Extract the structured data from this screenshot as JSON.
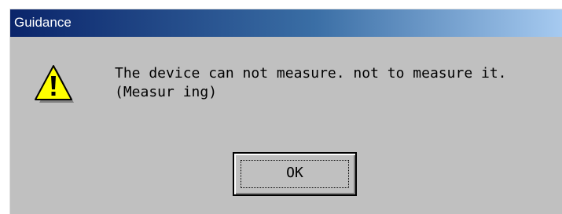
{
  "dialog": {
    "title": "Guidance",
    "icon": "warning-icon",
    "message_lines": [
      "The device can not measure. not to measure it.",
      "(Measur ing)"
    ],
    "ok_label": "OK"
  },
  "colors": {
    "titlebar_start": "#0a246a",
    "titlebar_end": "#a6caf0",
    "dialog_background": "#c0c0c0",
    "warning_yellow": "#ffff00"
  }
}
